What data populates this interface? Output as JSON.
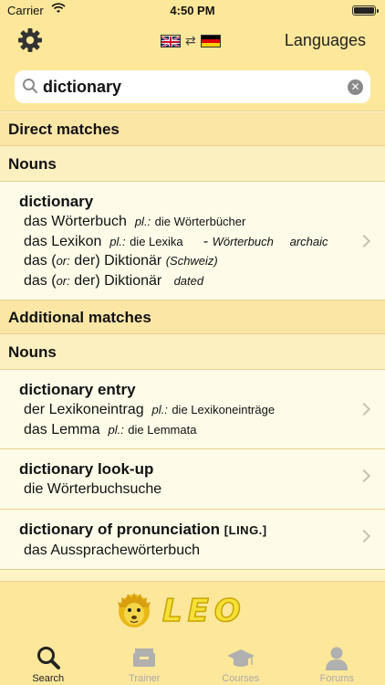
{
  "status": {
    "carrier": "Carrier",
    "time": "4:50 PM",
    "battery_level": 1.0
  },
  "navbar": {
    "settings_icon": "gear-icon",
    "from_flag": "uk-flag",
    "to_flag": "de-flag",
    "swap_icon": "swap-arrows-icon",
    "languages_label": "Languages"
  },
  "search": {
    "value": "dictionary",
    "placeholder": "",
    "clear_icon": "clear-icon"
  },
  "sections": {
    "direct": "Direct matches",
    "direct_nouns": "Nouns",
    "additional": "Additional matches",
    "additional_nouns": "Nouns"
  },
  "entries": [
    {
      "head": "dictionary",
      "lines": [
        {
          "a": "das Wörterbuch",
          "pl": "pl.:",
          "plural": "die Wörterbücher"
        },
        {
          "a": "das Lexikon",
          "pl": "pl.:",
          "plural": "die Lexika",
          "dash": "-",
          "note1": "Wörterbuch",
          "note2": "archaic"
        },
        {
          "a1": "das (",
          "or": "or:",
          "a2": "der) Diktionär",
          "note": "(Schweiz)"
        },
        {
          "a1": "das (",
          "or": "or:",
          "a2": "der) Diktionär",
          "note": "dated"
        }
      ]
    },
    {
      "head": "dictionary entry",
      "lines": [
        {
          "a": "der Lexikoneintrag",
          "pl": "pl.:",
          "plural": "die Lexikoneinträge"
        },
        {
          "a": "das Lemma",
          "pl": "pl.:",
          "plural": "die Lemmata"
        }
      ]
    },
    {
      "head": "dictionary look-up",
      "lines": [
        {
          "a": "die Wörterbuchsuche"
        }
      ]
    },
    {
      "head": "dictionary of pronunciation",
      "tag": "[LING.]",
      "lines": [
        {
          "a": "das Aussprachewörterbuch"
        }
      ]
    }
  ],
  "logo": {
    "text": "LEO"
  },
  "tabs": [
    {
      "label": "Search",
      "icon": "search-icon",
      "active": true
    },
    {
      "label": "Trainer",
      "icon": "card-box-icon",
      "active": false
    },
    {
      "label": "Courses",
      "icon": "graduation-cap-icon",
      "active": false
    },
    {
      "label": "Forums",
      "icon": "person-icon",
      "active": false
    }
  ],
  "colors": {
    "bar": "#fde79a",
    "section": "#fbe6a6",
    "row": "#fefce9",
    "text": "#111111"
  }
}
